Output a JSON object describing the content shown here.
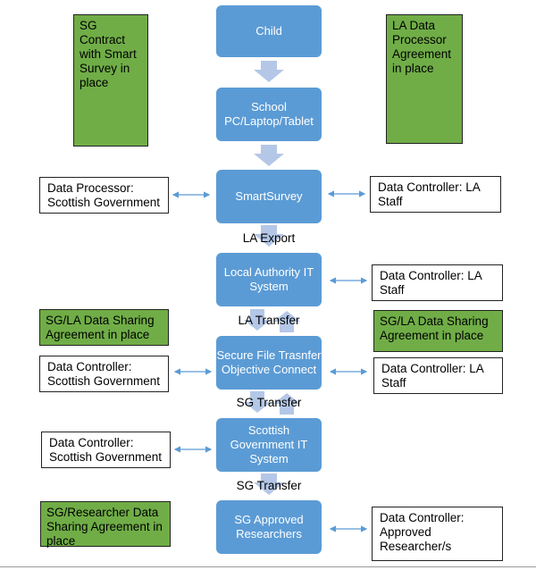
{
  "flow": [
    "Child",
    "School PC/Laptop/Tablet",
    "SmartSurvey",
    "Local Authority IT System",
    "Secure File Trasnfer Objective Connect",
    "Scottish Government IT System",
    "SG Approved Researchers"
  ],
  "transfers": [
    "LA Export",
    "LA Transfer",
    "SG Transfer",
    "SG Transfer"
  ],
  "agreements": [
    "SG Contract with Smart Survey in place",
    "LA Data Processor Agreement in place",
    "SG/LA Data Sharing Agreement in place",
    "SG/LA Data Sharing Agreement in place",
    "SG/Researcher Data Sharing Agreement in place"
  ],
  "roles": [
    "Data Processor: Scottish Government",
    "Data Controller: LA Staff",
    "Data Controller: LA Staff",
    "Data Controller: Scottish Government",
    "Data Controller: LA Staff",
    "Data Controller: Scottish Government",
    "Data Controller: Approved Researcher/s"
  ],
  "colors": {
    "process": "#5b9bd5",
    "agreement": "#70ad47",
    "arrow": "#b4c7e7"
  }
}
